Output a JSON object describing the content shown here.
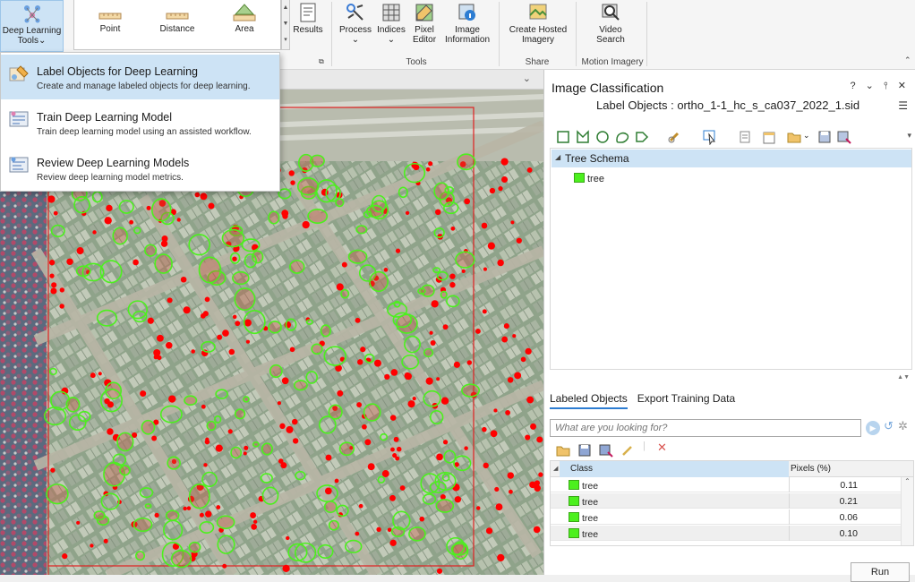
{
  "ribbon": {
    "deep_learning_label_1": "Deep Learning",
    "deep_learning_label_2": "Tools",
    "gallery": [
      "Point",
      "Distance",
      "Area"
    ],
    "results": "Results",
    "process": "Process",
    "indices": "Indices",
    "pixel_editor_1": "Pixel",
    "pixel_editor_2": "Editor",
    "image_info_1": "Image",
    "image_info_2": "Information",
    "hosted_1": "Create Hosted",
    "hosted_2": "Imagery",
    "video_1": "Video",
    "video_2": "Search",
    "group_tools": "Tools",
    "group_share": "Share",
    "group_motion": "Motion Imagery"
  },
  "dropdown": {
    "items": [
      {
        "title": "Label Objects for Deep Learning",
        "desc": "Create and manage labeled objects for deep learning."
      },
      {
        "title": "Train Deep Learning Model",
        "desc": "Train deep learning model using an assisted workflow."
      },
      {
        "title": "Review Deep Learning Models",
        "desc": "Review deep learning model metrics."
      }
    ]
  },
  "panel": {
    "title": "Image Classification",
    "controls": "? ⌄ ⫯ ✕",
    "subtitle": "Label Objects : ortho_1-1_hc_s_ca037_2022_1.sid",
    "schema": "Tree Schema",
    "schema_item": "tree",
    "tabs": [
      "Labeled Objects",
      "Export Training Data"
    ],
    "search_placeholder": "What are you looking for?",
    "columns": [
      "Class",
      "Pixels (%)"
    ],
    "rows": [
      {
        "class": "tree",
        "pixels": "0.11"
      },
      {
        "class": "tree",
        "pixels": "0.21"
      },
      {
        "class": "tree",
        "pixels": "0.06"
      },
      {
        "class": "tree",
        "pixels": "0.10"
      }
    ],
    "run": "Run"
  },
  "colors": {
    "accent": "#cde3f5",
    "tree_class": "#4cf01e",
    "label_red": "#ff0000"
  }
}
